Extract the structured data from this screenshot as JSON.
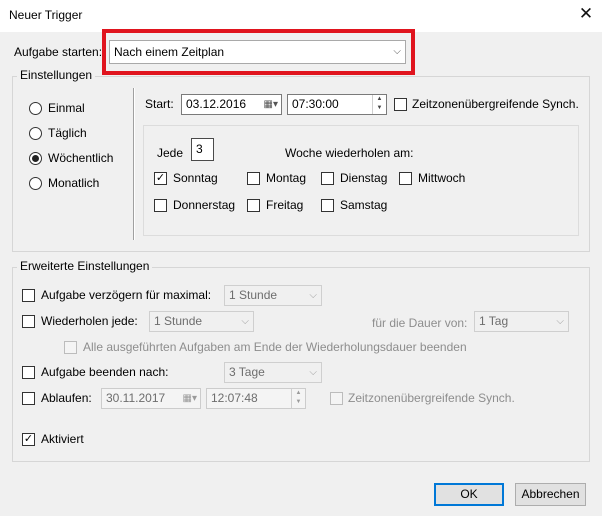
{
  "window": {
    "title": "Neuer Trigger",
    "close_glyph": "✕"
  },
  "start_task": {
    "label": "Aufgabe starten:",
    "selected": "Nach einem Zeitplan"
  },
  "settings": {
    "group_label": "Einstellungen",
    "options": [
      {
        "label": "Einmal",
        "selected": false
      },
      {
        "label": "Täglich",
        "selected": false
      },
      {
        "label": "Wöchentlich",
        "selected": true
      },
      {
        "label": "Monatlich",
        "selected": false
      }
    ],
    "start_label": "Start:",
    "start_date": "03.12.2016",
    "start_time": "07:30:00",
    "sync_label": "Zeitzonenübergreifende Synch.",
    "sync_checked": false,
    "every_label": "Jede",
    "every_value": "3",
    "repeat_label": "Woche wiederholen am:",
    "days": [
      {
        "label": "Sonntag",
        "checked": true
      },
      {
        "label": "Montag",
        "checked": false
      },
      {
        "label": "Dienstag",
        "checked": false
      },
      {
        "label": "Mittwoch",
        "checked": false
      },
      {
        "label": "Donnerstag",
        "checked": false
      },
      {
        "label": "Freitag",
        "checked": false
      },
      {
        "label": "Samstag",
        "checked": false
      }
    ]
  },
  "advanced": {
    "group_label": "Erweiterte Einstellungen",
    "delay_label": "Aufgabe verzögern für maximal:",
    "delay_value": "1 Stunde",
    "repeat_label": "Wiederholen jede:",
    "repeat_value": "1 Stunde",
    "duration_label": "für die Dauer von:",
    "duration_value": "1 Tag",
    "stop_all_label": "Alle ausgeführten Aufgaben am Ende der Wiederholungsdauer beenden",
    "stop_after_label": "Aufgabe beenden nach:",
    "stop_after_value": "3 Tage",
    "expire_label": "Ablaufen:",
    "expire_date": "30.11.2017",
    "expire_time": "12:07:48",
    "expire_sync_label": "Zeitzonenübergreifende Synch.",
    "enabled_label": "Aktiviert",
    "enabled_checked": true
  },
  "buttons": {
    "ok": "OK",
    "cancel": "Abbrechen"
  },
  "colors": {
    "highlight": "#e0141e",
    "default_button_border": "#0078d7"
  }
}
